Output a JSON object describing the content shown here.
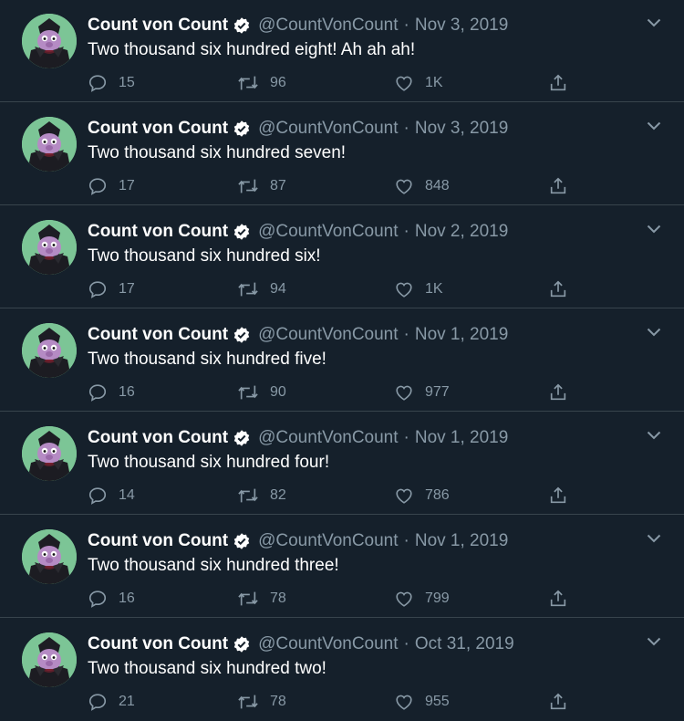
{
  "account": {
    "name": "Count von Count",
    "handle": "@CountVonCount",
    "separator": "·"
  },
  "colors": {
    "background": "#15202b",
    "text": "#ffffff",
    "muted": "#8899a6",
    "divider": "#38444d"
  },
  "icons": [
    "verified-badge-icon",
    "chevron-down-icon",
    "reply-icon",
    "retweet-icon",
    "like-icon",
    "share-icon"
  ],
  "tweets": [
    {
      "date": "Nov 3, 2019",
      "text": "Two thousand six hundred eight! Ah ah ah!",
      "replies": "15",
      "retweets": "96",
      "likes": "1K"
    },
    {
      "date": "Nov 3, 2019",
      "text": "Two thousand six hundred seven!",
      "replies": "17",
      "retweets": "87",
      "likes": "848"
    },
    {
      "date": "Nov 2, 2019",
      "text": "Two thousand six hundred six!",
      "replies": "17",
      "retweets": "94",
      "likes": "1K"
    },
    {
      "date": "Nov 1, 2019",
      "text": "Two thousand six hundred five!",
      "replies": "16",
      "retweets": "90",
      "likes": "977"
    },
    {
      "date": "Nov 1, 2019",
      "text": "Two thousand six hundred four!",
      "replies": "14",
      "retweets": "82",
      "likes": "786"
    },
    {
      "date": "Nov 1, 2019",
      "text": "Two thousand six hundred three!",
      "replies": "16",
      "retweets": "78",
      "likes": "799"
    },
    {
      "date": "Oct 31, 2019",
      "text": "Two thousand six hundred two!",
      "replies": "21",
      "retweets": "78",
      "likes": "955"
    }
  ]
}
